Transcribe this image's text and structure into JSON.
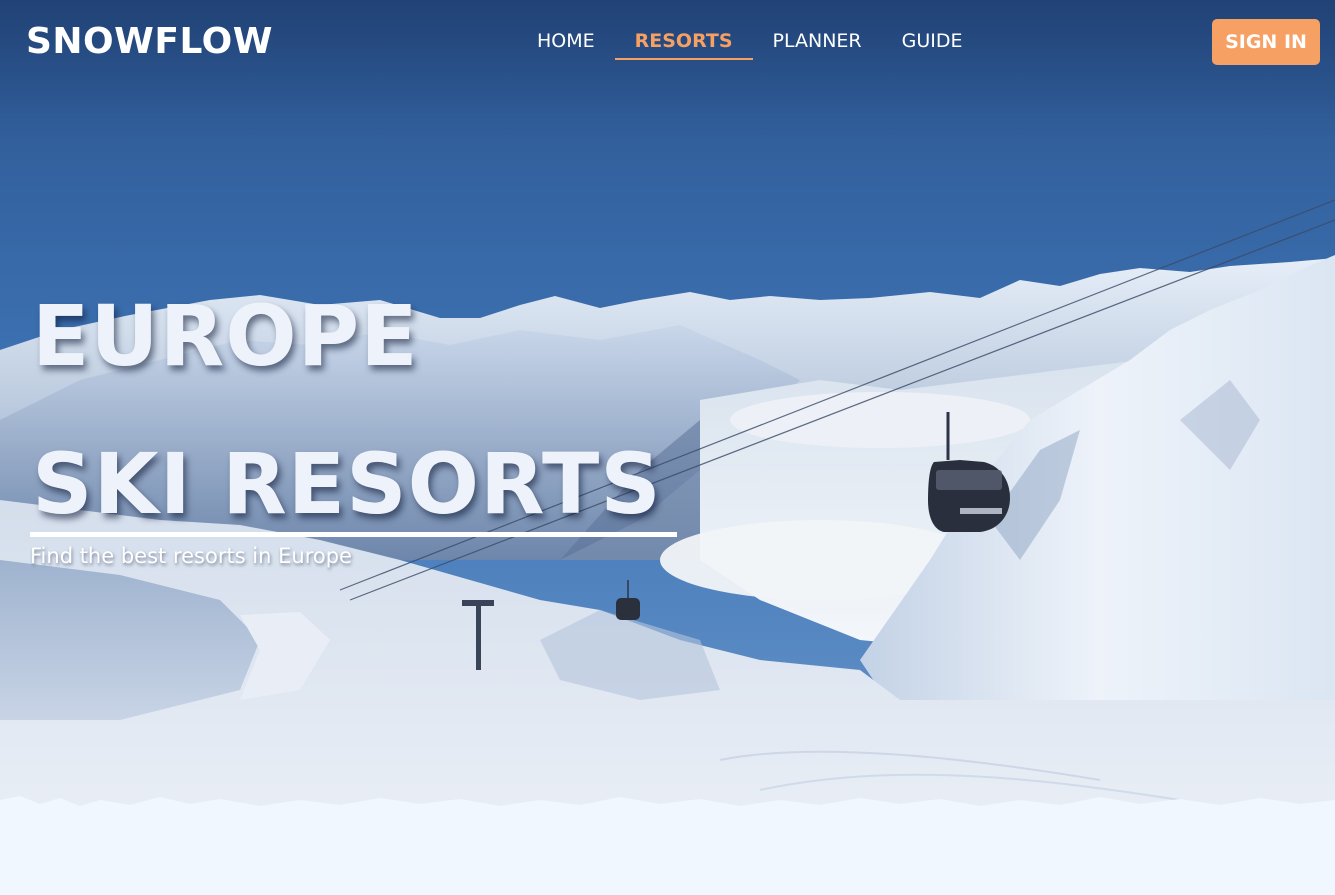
{
  "brand": {
    "name": "SNOWFLOW"
  },
  "nav": {
    "items": [
      {
        "label": "HOME",
        "active": false
      },
      {
        "label": "RESORTS",
        "active": true
      },
      {
        "label": "PLANNER",
        "active": false
      },
      {
        "label": "GUIDE",
        "active": false
      }
    ],
    "signin_label": "SIGN IN"
  },
  "hero": {
    "title_line1": "EUROPE",
    "title_line2": "SKI RESORTS",
    "subtitle": "Find the best resorts in Europe"
  },
  "colors": {
    "accent": "#f6a064",
    "page_bg": "#f1f7ff",
    "title": "#eef3fb",
    "sky_top": "#2f5a92",
    "snow": "#eef3fb"
  }
}
